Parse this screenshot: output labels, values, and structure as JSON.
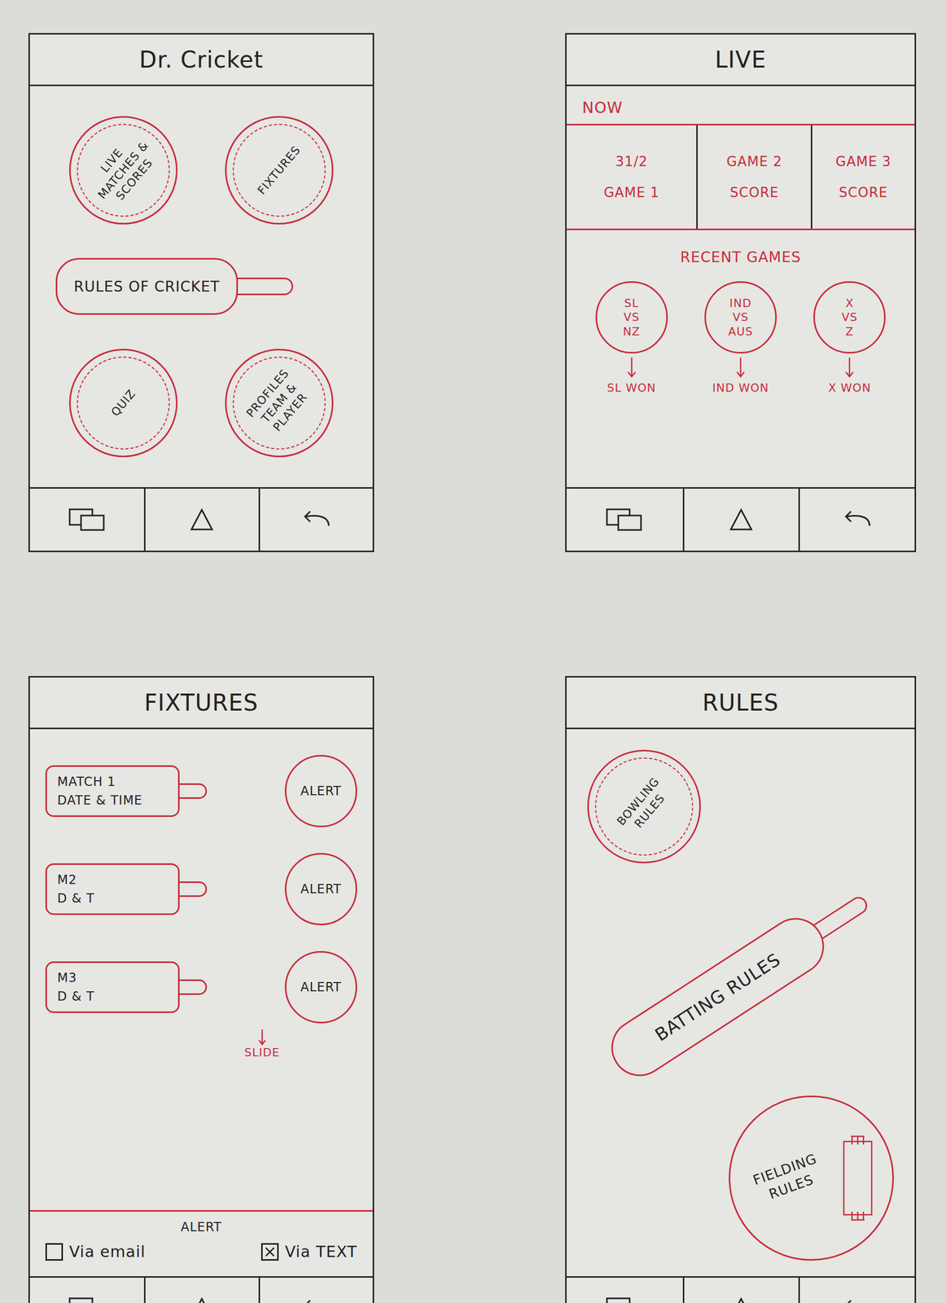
{
  "screens": [
    {
      "kind": "home",
      "title": "Dr. Cricket",
      "buttons": [
        {
          "label": "LIVE MATCHES & SCORES",
          "kind": "ball"
        },
        {
          "label": "FIXTURES",
          "kind": "ball"
        },
        {
          "label": "RULES OF CRICKET",
          "kind": "bat"
        },
        {
          "label": "QUIZ",
          "kind": "ball"
        },
        {
          "label": "PROFILES TEAM & PLAYER",
          "kind": "ball"
        }
      ]
    },
    {
      "kind": "live",
      "title": "LIVE",
      "now_label": "NOW",
      "now_games": [
        {
          "lines": [
            "31/2",
            "GAME 1"
          ]
        },
        {
          "lines": [
            "GAME 2",
            "SCORE"
          ]
        },
        {
          "lines": [
            "GAME 3",
            "SCORE"
          ]
        }
      ],
      "recent_label": "RECENT GAMES",
      "recent_games": [
        {
          "lines": [
            "SL",
            "VS",
            "NZ"
          ],
          "result": "SL WON"
        },
        {
          "lines": [
            "IND",
            "VS",
            "AUS"
          ],
          "result": "IND WON"
        },
        {
          "lines": [
            "X",
            "VS",
            "Z"
          ],
          "result": "X WON"
        }
      ]
    },
    {
      "kind": "fixtures",
      "title": "FIXTURES",
      "matches": [
        {
          "name": "MATCH 1",
          "when": "DATE & TIME",
          "alert": "ALERT"
        },
        {
          "name": "M2",
          "when": "D & T",
          "alert": "ALERT"
        },
        {
          "name": "M3",
          "when": "D & T",
          "alert": "ALERT"
        }
      ],
      "more": "SLIDE",
      "alert_label": "ALERT",
      "alert_options": [
        {
          "label": "Via email",
          "checked": false
        },
        {
          "label": "Via TEXT",
          "checked": true
        }
      ]
    },
    {
      "kind": "rules",
      "title": "RULES",
      "items": [
        {
          "label": "BOWLING RULES",
          "kind": "ball"
        },
        {
          "label": "BATTING RULES",
          "kind": "bat"
        },
        {
          "label": "FIELDING RULES",
          "kind": "field"
        }
      ]
    }
  ]
}
